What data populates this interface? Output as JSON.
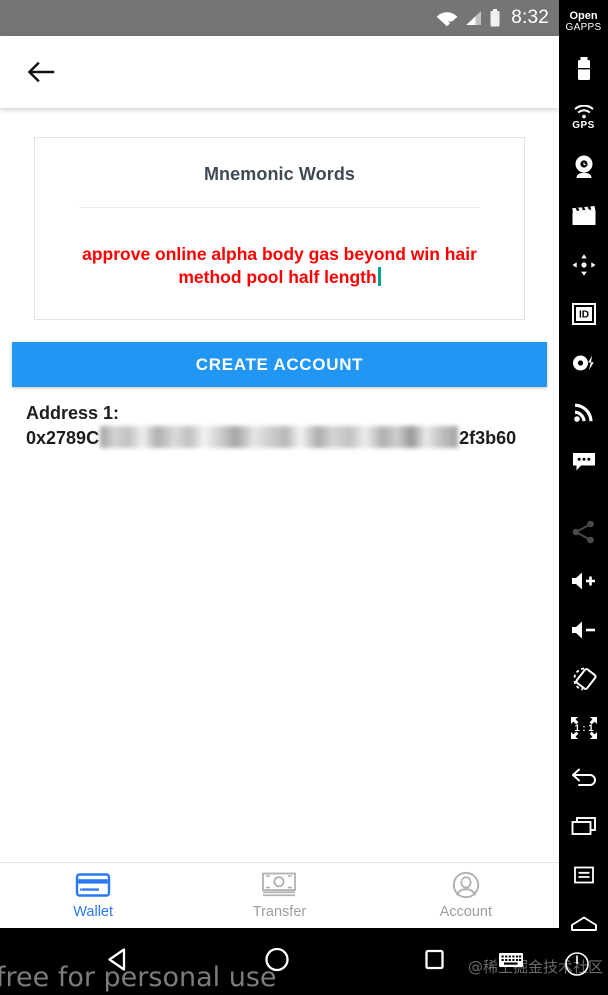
{
  "statusbar": {
    "time": "8:32",
    "icons": [
      "wifi-no-connection-icon",
      "cellular-signal-icon",
      "battery-icon"
    ]
  },
  "appbar": {
    "back_label": "back-arrow"
  },
  "card": {
    "title": "Mnemonic Words",
    "mnemonic": "approve online alpha body gas beyond win hair method pool half length",
    "mnemonic_color": "#fe0000",
    "caret_color": "#00a28f"
  },
  "actions": {
    "create_account_label": "CREATE ACCOUNT",
    "create_account_color": "#2196f3"
  },
  "address": {
    "label": "Address 1:",
    "prefix": "0x2789C",
    "suffix": "2f3b60",
    "redacted": true
  },
  "tabbar": {
    "items": [
      {
        "label": "Wallet",
        "icon": "credit-card-icon",
        "active": true
      },
      {
        "label": "Transfer",
        "icon": "banknotes-icon",
        "active": false
      },
      {
        "label": "Account",
        "icon": "person-circle-icon",
        "active": false
      }
    ],
    "active_color": "#2979f2",
    "inactive_color": "#9e9e9e"
  },
  "navbar": {
    "back": "triangle-back-icon",
    "home": "circle-home-icon",
    "recents": "square-recents-icon",
    "keyboard": "keyboard-icon",
    "power": "power-icon",
    "watermark_left": "free for personal use",
    "watermark_right": "@稀土掘金技术社区"
  },
  "toolbar": {
    "logo_line1": "Open",
    "logo_line2": "GAPPS",
    "gps_label": "GPS",
    "ratio_label": "1 : 1",
    "items": [
      "battery-icon",
      "gps-icon",
      "webcam-icon",
      "clapperboard-icon",
      "dpad-move-icon",
      "id-card-icon",
      "record-bolt-icon",
      "rss-signal-icon",
      "chat-bubble-icon",
      "share-icon",
      "volume-up-icon",
      "volume-down-icon",
      "rotate-icon",
      "resize-1-1-icon",
      "back-arrow-icon",
      "overview-windows-icon",
      "menu-icon",
      "home-icon"
    ]
  }
}
